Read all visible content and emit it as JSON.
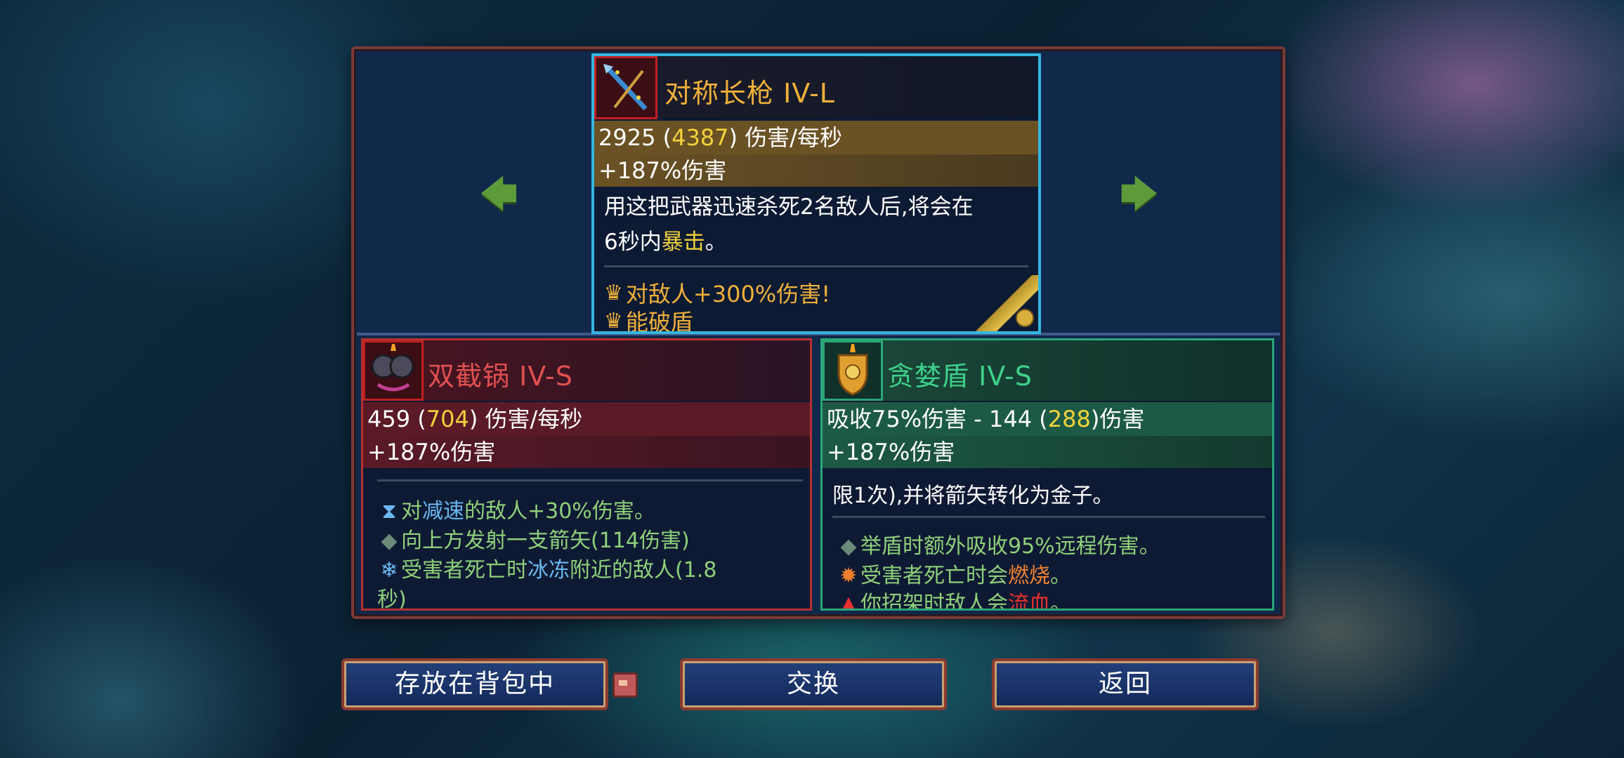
{
  "top_weapon": {
    "name": "对称长枪  IV-L",
    "dps_base": "2925 (",
    "dps_high": "4387",
    "dps_suffix": ") 伤害/每秒",
    "bonus": "+187%伤害",
    "desc_a": "用这把武器迅速杀死2名敌人后,将会在",
    "desc_b": "6秒内",
    "desc_crit": "暴击",
    "desc_end": "。",
    "mut_1": "对敌人+300%伤害!",
    "mut_2": "能破盾"
  },
  "left_item": {
    "name": "双截锅  IV-S",
    "dps_base": "459 (",
    "dps_high": "704",
    "dps_suffix": ") 伤害/每秒",
    "bonus": "+187%伤害",
    "line1_a": "对",
    "line1_b": "减速",
    "line1_c": "的敌人+30%伤害。",
    "line2": "向上方发射一支箭矢(114伤害)",
    "line3_a": "受害者死亡时",
    "line3_b": "冰冻",
    "line3_c": "附近的敌人(1.8",
    "line4": "秒)"
  },
  "right_item": {
    "name": "贪婪盾  IV-S",
    "stat_a": "吸收75%伤害 - 144 (",
    "stat_high": "288",
    "stat_b": ")伤害",
    "bonus": "+187%伤害",
    "desc": "限1次),并将箭矢转化为金子。",
    "line1": "举盾时额外吸收95%远程伤害。",
    "line2_a": "受害者死亡时会",
    "line2_b": "燃烧",
    "line2_c": "。",
    "line3_a": "你招架时敌人会",
    "line3_b": "流血",
    "line3_c": "。"
  },
  "buttons": {
    "store": "存放在背包中",
    "swap": "交换",
    "back": "返回"
  },
  "icons": {
    "left_arrow": "arrow-left-icon",
    "right_arrow": "arrow-right-icon",
    "crown": "crown-icon",
    "bag": "backpack-icon"
  },
  "colors": {
    "accent_top": "#34b6e0",
    "accent_left": "#b83030",
    "accent_right": "#2aa678",
    "title_gold": "#f0b03a"
  }
}
